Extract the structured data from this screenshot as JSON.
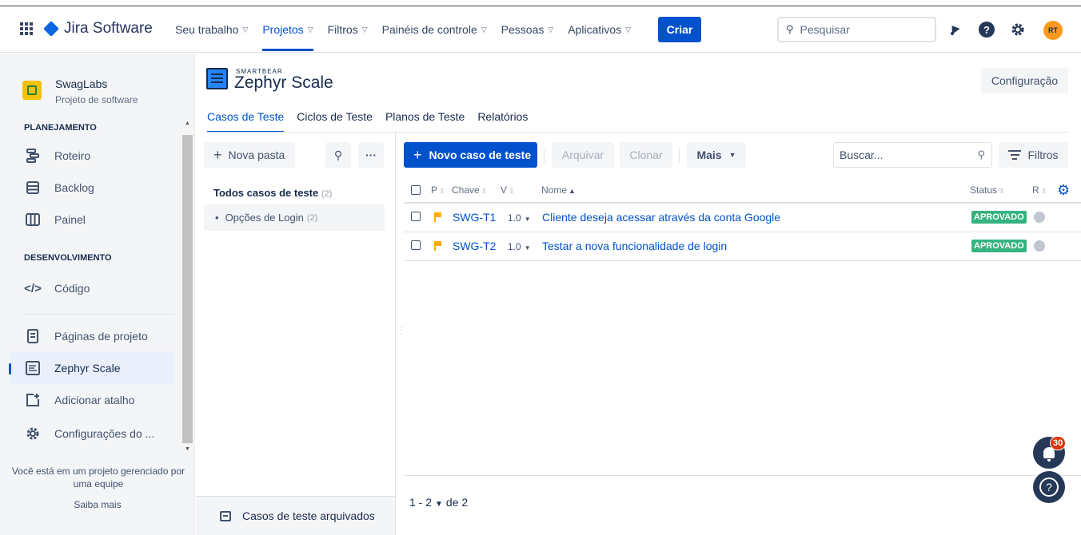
{
  "topnav": {
    "product": "Jira Software",
    "menu": [
      {
        "label": "Seu trabalho",
        "chevron": true,
        "active": false
      },
      {
        "label": "Projetos",
        "chevron": true,
        "active": true
      },
      {
        "label": "Filtros",
        "chevron": true,
        "active": false
      },
      {
        "label": "Painéis de controle",
        "chevron": true,
        "active": false
      },
      {
        "label": "Pessoas",
        "chevron": true,
        "active": false
      },
      {
        "label": "Aplicativos",
        "chevron": true,
        "active": false
      }
    ],
    "create_label": "Criar",
    "search_placeholder": "Pesquisar",
    "avatar_initials": "RT"
  },
  "sidebar": {
    "project_name": "SwagLabs",
    "project_type": "Projeto de software",
    "planning_title": "PLANEJAMENTO",
    "planning_items": [
      {
        "label": "Roteiro",
        "icon": "roadmap-icon"
      },
      {
        "label": "Backlog",
        "icon": "backlog-icon"
      },
      {
        "label": "Painel",
        "icon": "board-icon"
      }
    ],
    "development_title": "DESENVOLVIMENTO",
    "development_items": [
      {
        "label": "Código",
        "icon": "code-icon"
      }
    ],
    "other_items": [
      {
        "label": "Páginas de projeto",
        "icon": "pages-icon"
      },
      {
        "label": "Zephyr Scale",
        "icon": "zephyr-icon",
        "selected": true
      },
      {
        "label": "Adicionar atalho",
        "icon": "add-shortcut-icon"
      },
      {
        "label": "Configurações do ...",
        "icon": "settings-gear-icon"
      }
    ],
    "footer_text": "Você está em um projeto gerenciado por uma equipe",
    "footer_link": "Saiba mais"
  },
  "zephyr": {
    "brand_small": "SMARTBEAR",
    "brand_title": "Zephyr Scale",
    "config_label": "Configuração",
    "tabs": [
      {
        "label": "Casos de Teste",
        "active": true
      },
      {
        "label": "Ciclos de Teste",
        "active": false
      },
      {
        "label": "Planos de Teste",
        "active": false
      },
      {
        "label": "Relatórios",
        "active": false
      }
    ]
  },
  "folders": {
    "new_folder_label": "Nova pasta",
    "root_label": "Todos casos de teste",
    "root_count": "(2)",
    "children": [
      {
        "label": "Opções de Login",
        "count": "(2)"
      }
    ],
    "archived_label": "Casos de teste arquivados"
  },
  "toolbar": {
    "new_case_label": "Novo caso de teste",
    "archive_label": "Arquivar",
    "clone_label": "Clonar",
    "more_label": "Mais",
    "search_placeholder": "Buscar...",
    "filters_label": "Filtros"
  },
  "table": {
    "columns": {
      "priority": "P",
      "key": "Chave",
      "version": "V",
      "name": "Nome",
      "status": "Status",
      "r": "R"
    },
    "rows": [
      {
        "key": "SWG-T1",
        "version": "1.0",
        "name": "Cliente deseja acessar através da conta Google",
        "status": "APROVADO",
        "priority_color": "#ffab00",
        "status_color": "#36b37e"
      },
      {
        "key": "SWG-T2",
        "version": "1.0",
        "name": "Testar a nova funcionalidade de login",
        "status": "APROVADO",
        "priority_color": "#ffab00",
        "status_color": "#36b37e"
      }
    ]
  },
  "pager": {
    "range": "1 - 2",
    "of_total": "de 2"
  },
  "notifications": {
    "count": "30"
  },
  "colors": {
    "primary": "#0052cc",
    "approved": "#36b37e",
    "priority": "#ffab00",
    "avatar": "#ff991f",
    "badge": "#de350b"
  }
}
